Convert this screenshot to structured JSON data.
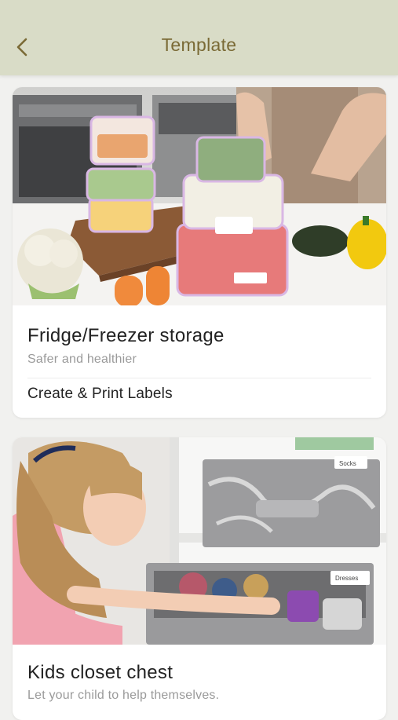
{
  "header": {
    "title": "Template",
    "back_icon": "chevron-left-icon",
    "background": "#d9dcc7",
    "title_color": "#7a6a35"
  },
  "cards": [
    {
      "title": "Fridge/Freezer storage",
      "subtitle": "Safer and healthier",
      "action": "Create & Print Labels",
      "image": "food-storage-containers-photo"
    },
    {
      "title": "Kids closet chest",
      "subtitle": "Let your child to help themselves.",
      "image": "kids-closet-chest-photo",
      "drawer_labels": [
        "Socks",
        "Dresses"
      ]
    }
  ]
}
